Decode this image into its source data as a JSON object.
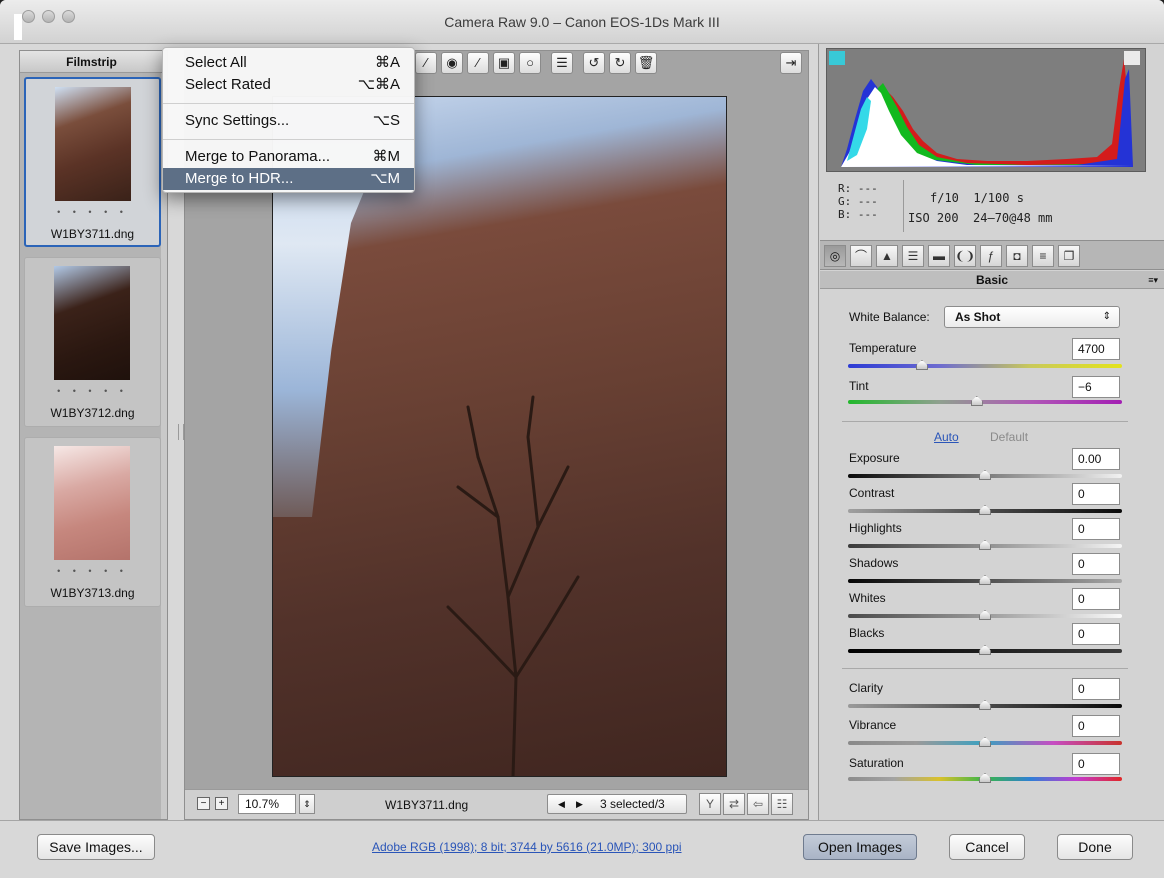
{
  "window": {
    "title": "Camera Raw 9.0  –  Canon EOS-1Ds Mark III"
  },
  "filmstrip": {
    "header": "Filmstrip",
    "items": [
      {
        "file": "W1BY3711.dng",
        "stars": "• • • • •",
        "selected": true
      },
      {
        "file": "W1BY3712.dng",
        "stars": "• • • • •",
        "selected": false
      },
      {
        "file": "W1BY3713.dng",
        "stars": "• • • • •",
        "selected": false
      }
    ]
  },
  "context_menu": {
    "items": [
      {
        "label": "Select All",
        "shortcut": "⌘A"
      },
      {
        "label": "Select Rated",
        "shortcut": "⌥⌘A"
      },
      {
        "label": "Sync Settings...",
        "shortcut": "⌥S"
      },
      {
        "label": "Merge to Panorama...",
        "shortcut": "⌘M"
      },
      {
        "label": "Merge to HDR...",
        "shortcut": "⌥M",
        "highlighted": true
      }
    ]
  },
  "toolbar": {
    "tools": [
      "brush-plus-icon",
      "red-eye-icon",
      "adjustment-brush-icon",
      "graduated-filter-icon",
      "radial-filter-icon",
      "preferences-icon",
      "rotate-left-icon",
      "rotate-right-icon",
      "trash-icon"
    ],
    "fullscreen_icon": "toggle-fullscreen-icon"
  },
  "status": {
    "zoom": "10.7%",
    "filename": "W1BY3711.dng",
    "selection": "3 selected/3"
  },
  "histogram": {
    "r": "R:   ---",
    "g": "G:   ---",
    "b": "B:   ---",
    "aperture": "f/10",
    "shutter": "1/100 s",
    "iso": "ISO 200",
    "lens": "24–70@48 mm"
  },
  "panel": {
    "title": "Basic",
    "white_balance_label": "White Balance:",
    "white_balance_value": "As Shot",
    "auto_label": "Auto",
    "default_label": "Default",
    "sliders": {
      "temperature": {
        "label": "Temperature",
        "value": "4700",
        "level": 0.27
      },
      "tint": {
        "label": "Tint",
        "value": "−6",
        "level": 0.47
      },
      "exposure": {
        "label": "Exposure",
        "value": "0.00",
        "level": 0.5
      },
      "contrast": {
        "label": "Contrast",
        "value": "0",
        "level": 0.5
      },
      "highlights": {
        "label": "Highlights",
        "value": "0",
        "level": 0.5
      },
      "shadows": {
        "label": "Shadows",
        "value": "0",
        "level": 0.5
      },
      "whites": {
        "label": "Whites",
        "value": "0",
        "level": 0.5
      },
      "blacks": {
        "label": "Blacks",
        "value": "0",
        "level": 0.5
      },
      "clarity": {
        "label": "Clarity",
        "value": "0",
        "level": 0.5
      },
      "vibrance": {
        "label": "Vibrance",
        "value": "0",
        "level": 0.5
      },
      "saturation": {
        "label": "Saturation",
        "value": "0",
        "level": 0.5
      }
    }
  },
  "footer": {
    "save_label": "Save Images...",
    "workflow_link": "Adobe RGB (1998); 8 bit; 3744 by 5616 (21.0MP); 300 ppi",
    "open_label": "Open Images",
    "cancel_label": "Cancel",
    "done_label": "Done"
  },
  "colors": {
    "selection_blue": "#2b64b8",
    "menu_highlight": "#5d6f86",
    "link_blue": "#2a55b8"
  }
}
